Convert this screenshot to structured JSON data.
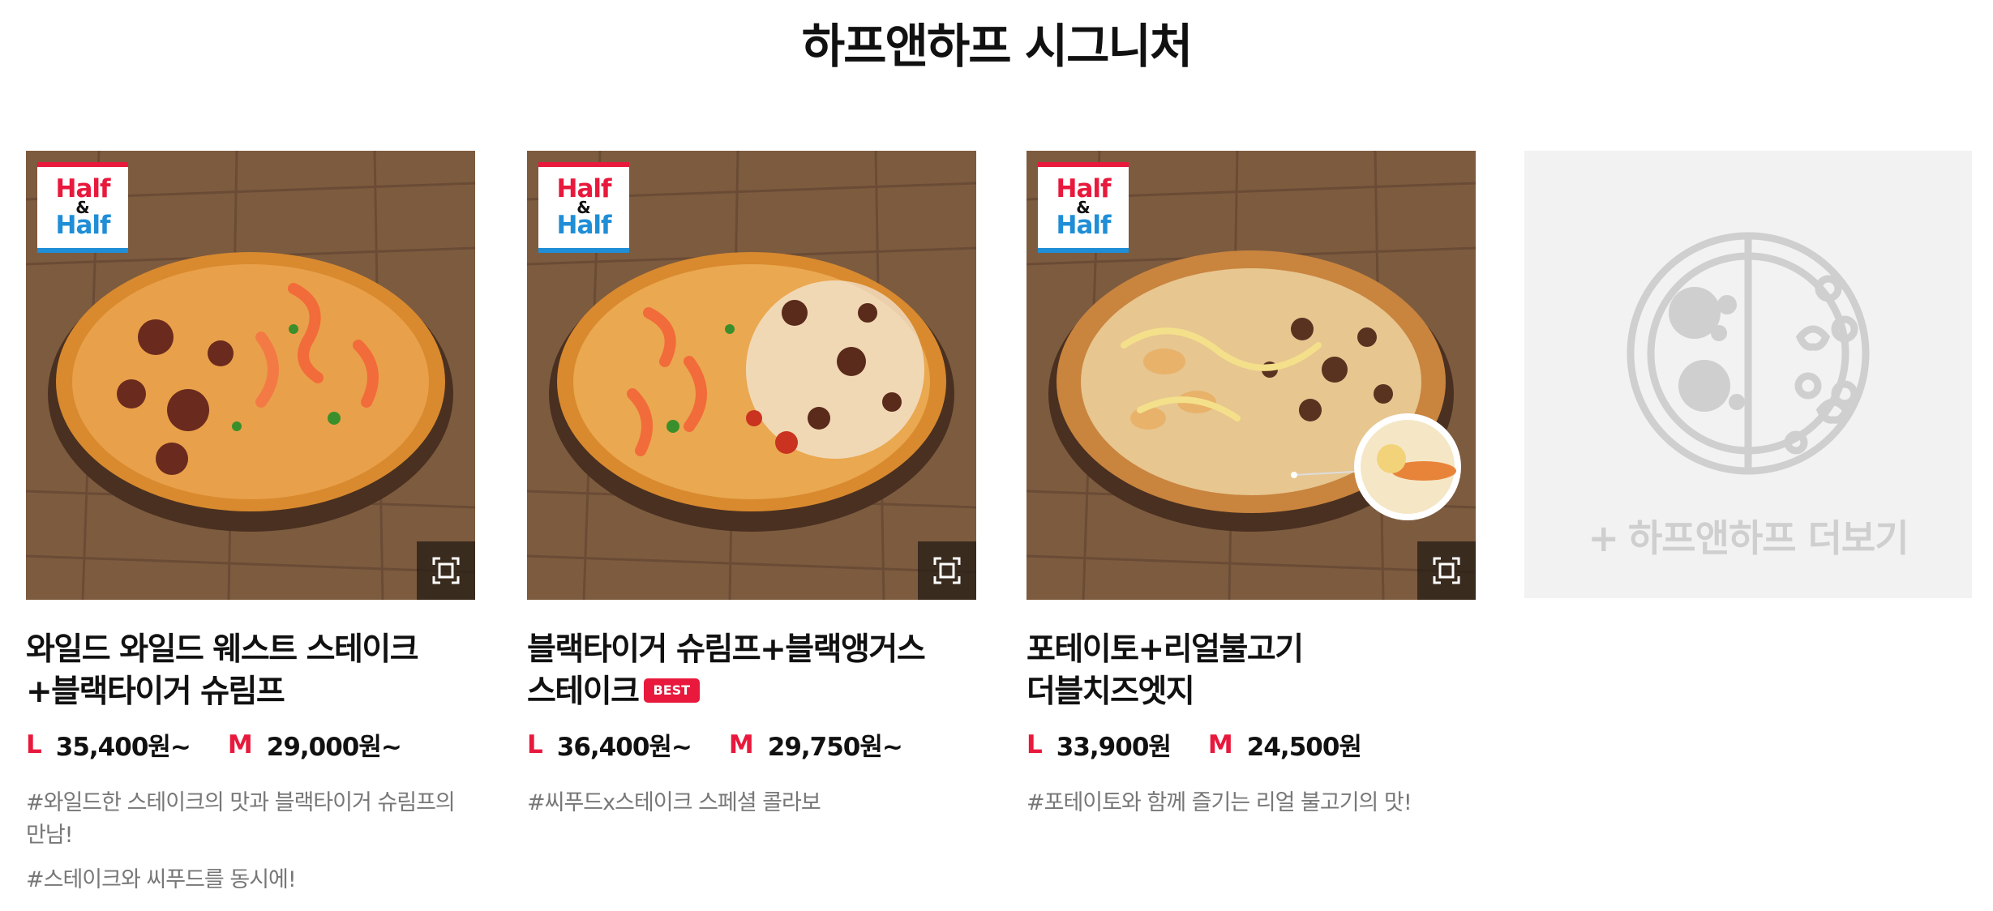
{
  "section": {
    "title": "하프앤하프 시그니처"
  },
  "badge": {
    "line1": "Half",
    "amp": "&",
    "line2": "Half"
  },
  "products": [
    {
      "name": "와일드 와일드 웨스트 스테이크+블랙타이거 슈림프",
      "best": "",
      "size_l": "L",
      "price_l": "35,400원~",
      "size_m": "M",
      "price_m": "29,000원~",
      "tags": [
        "#와일드한 스테이크의 맛과 블랙타이거 슈림프의 만남!",
        "#스테이크와 씨푸드를 동시에!"
      ]
    },
    {
      "name": "블랙타이거 슈림프+블랙앵거스 스테이크",
      "best": "BEST",
      "size_l": "L",
      "price_l": "36,400원~",
      "size_m": "M",
      "price_m": "29,750원~",
      "tags": [
        "#씨푸드x스테이크 스페셜 콜라보"
      ]
    },
    {
      "name": "포테이토+리얼불고기 더블치즈엣지",
      "best": "",
      "size_l": "L",
      "price_l": "33,900원",
      "size_m": "M",
      "price_m": "24,500원",
      "tags": [
        "#포테이토와 함께 즐기는 리얼 불고기의 맛!"
      ]
    }
  ],
  "more": {
    "plus": "+",
    "label": "하프앤하프 더보기"
  },
  "colors": {
    "accent": "#e8193c",
    "logo_blue": "#1f8ed6",
    "muted": "#777777",
    "placeholder": "#f2f2f2"
  },
  "icons": {
    "zoom": "expand-icon",
    "more": "half-half-pizza-icon"
  }
}
